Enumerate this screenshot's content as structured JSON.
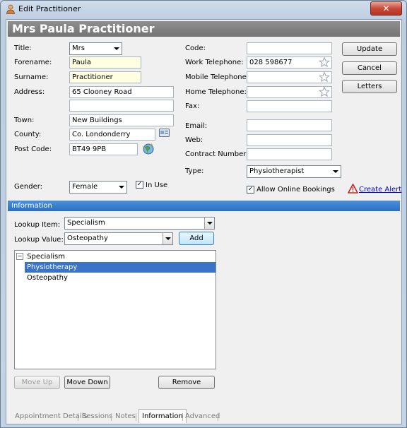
{
  "window": {
    "title": "Edit Practitioner",
    "close_label": "✕"
  },
  "header": {
    "title": "Mrs Paula Practitioner"
  },
  "form": {
    "title_label": "Title:",
    "title_value": "Mrs",
    "forename_label": "Forename:",
    "forename_value": "Paula",
    "surname_label": "Surname:",
    "surname_value": "Practitioner",
    "address_label": "Address:",
    "address_line1": "65 Clooney Road",
    "address_line2": "",
    "town_label": "Town:",
    "town_value": "New Buildings",
    "county_label": "County:",
    "county_value": "Co.  Londonderry",
    "postcode_label": "Post Code:",
    "postcode_value": "BT49 9PB",
    "gender_label": "Gender:",
    "gender_value": "Female",
    "in_use_label": "In Use",
    "in_use_checked": "✓",
    "code_label": "Code:",
    "code_value": "",
    "work_tel_label": "Work Telephone:",
    "work_tel_value": "028 598677",
    "mobile_tel_label": "Mobile Telephone:",
    "mobile_tel_value": "",
    "home_tel_label": "Home Telephone:",
    "home_tel_value": "",
    "fax_label": "Fax:",
    "fax_value": "",
    "email_label": "Email:",
    "email_value": "",
    "web_label": "Web:",
    "web_value": "",
    "contract_label": "Contract Number:",
    "contract_value": "",
    "type_label": "Type:",
    "type_value": "Physiotherapist",
    "online_label": "Allow Online Bookings",
    "online_checked": "✓",
    "alert_label": "Create Alert"
  },
  "side_buttons": {
    "update": "Update",
    "cancel": "Cancel",
    "letters": "Letters"
  },
  "information": {
    "section_title": "Information",
    "lookup_item_label": "Lookup Item:",
    "lookup_item_value": "Specialism",
    "lookup_value_label": "Lookup Value:",
    "lookup_value_value": "Osteopathy",
    "add_label": "Add",
    "tree": {
      "root_toggle": "−",
      "root": "Specialism",
      "items": [
        "Physiotherapy",
        "Osteopathy"
      ],
      "selected_index": 0
    },
    "move_up": "Move Up",
    "move_down": "Move Down",
    "remove": "Remove"
  },
  "tabs": [
    "Appointment Details",
    "Sessions",
    "Notes",
    "Information",
    "Advanced"
  ],
  "active_tab": "Information",
  "colors": {
    "header": "#7f7f7f",
    "section_bar": "#3a80d0",
    "selection": "#3a73c8",
    "required_field": "#ffffe1",
    "alert": "#cc2222"
  }
}
